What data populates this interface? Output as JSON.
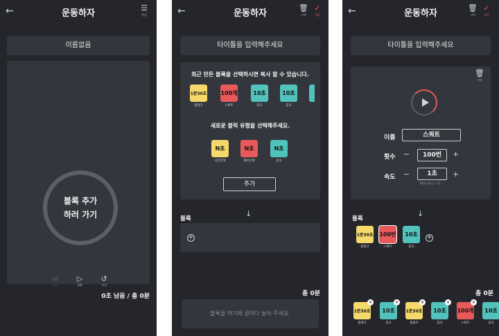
{
  "app_title": "운동하자",
  "screen1": {
    "header_action": {
      "icon": "sliders-icon",
      "label": "편집"
    },
    "name": "이름없음",
    "circle_text": "블록 추가\n하러 가기",
    "controls": [
      {
        "icon": "repeat-icon",
        "label": "반복"
      },
      {
        "icon": "play-icon",
        "label": "실행"
      },
      {
        "icon": "reset-icon",
        "label": "리셋"
      }
    ],
    "summary": "0초 남음 / 총 0분"
  },
  "screen2": {
    "header_actions": [
      {
        "icon": "trash-icon",
        "label": "삭제"
      },
      {
        "icon": "check-icon",
        "label": "저장"
      }
    ],
    "title_placeholder": "타이틀을 입력해주세요",
    "recent_label": "최근 만든 블록을 선택하시면 복사 할 수 있습니다.",
    "recent_blocks": [
      {
        "text": "1분30초",
        "caption": "플랭크",
        "color": "y"
      },
      {
        "text": "100개",
        "caption": "스쿼트",
        "color": "r"
      },
      {
        "text": "10초",
        "caption": "휴식",
        "color": "t"
      },
      {
        "text": "10초",
        "caption": "휴식",
        "color": "t"
      }
    ],
    "type_label": "새로운 블럭 유형을 선택해주세요.",
    "block_types": [
      {
        "text": "N초",
        "caption": "시간단위",
        "color": "y"
      },
      {
        "text": "N초",
        "caption": "횟수단위",
        "color": "r"
      },
      {
        "text": "N초",
        "caption": "휴식",
        "color": "t"
      }
    ],
    "add_button": "추가",
    "blocks_section": "블록",
    "total": "총 0분",
    "dropzone": "블록을 여기에 끌어다 놓아 주세요."
  },
  "screen3": {
    "header_actions": [
      {
        "icon": "trash-icon",
        "label": "삭제"
      },
      {
        "icon": "check-icon",
        "label": "저장"
      }
    ],
    "title_placeholder": "타이틀을 입력해주세요",
    "editor": {
      "delete_label": "삭제",
      "name_label": "이름",
      "name_value": "스쿼트",
      "count_label": "횟수",
      "count_value": "100번",
      "speed_label": "속도",
      "speed_value": "1초",
      "speed_hint": "1회에 걸리는 시간"
    },
    "blocks_section": "블록",
    "blocks": [
      {
        "text": "1분30초",
        "caption": "플랭크",
        "color": "y"
      },
      {
        "text": "100번",
        "caption": "스쿼트",
        "color": "r"
      },
      {
        "text": "10초",
        "caption": "휴식",
        "color": "t"
      }
    ],
    "total": "총 0분",
    "tray": [
      {
        "text": "1분30초",
        "caption": "플랭크",
        "color": "y"
      },
      {
        "text": "10초",
        "caption": "휴식",
        "color": "t"
      },
      {
        "text": "1분30초",
        "caption": "플랭크",
        "color": "y"
      },
      {
        "text": "10초",
        "caption": "휴식",
        "color": "t"
      },
      {
        "text": "100개",
        "caption": "스쿼트",
        "color": "r"
      },
      {
        "text": "10초",
        "caption": "휴식",
        "color": "t"
      }
    ]
  }
}
